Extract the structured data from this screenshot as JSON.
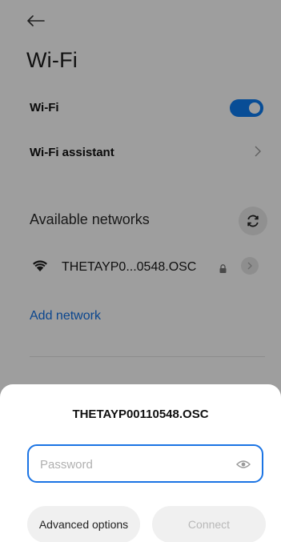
{
  "header": {
    "title": "Wi-Fi"
  },
  "settings": {
    "wifi_label": "Wi-Fi",
    "wifi_enabled": true,
    "assistant_label": "Wi-Fi assistant"
  },
  "networks": {
    "section_title": "Available networks",
    "items": [
      {
        "name": "THETAYP0...0548.OSC",
        "secured": true
      }
    ],
    "add_label": "Add network"
  },
  "dialog": {
    "title": "THETAYP00110548.OSC",
    "password_placeholder": "Password",
    "password_value": "",
    "advanced_label": "Advanced options",
    "connect_label": "Connect"
  },
  "colors": {
    "accent": "#1272e6",
    "toggle_on": "#0d7cf2"
  },
  "icons": [
    "back-arrow-icon",
    "chevron-right-icon",
    "refresh-icon",
    "wifi-icon",
    "lock-icon",
    "eye-icon"
  ]
}
